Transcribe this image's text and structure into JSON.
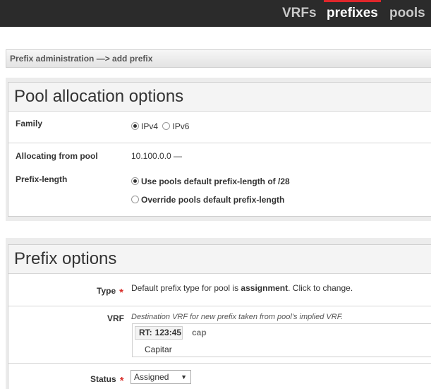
{
  "nav": {
    "items": [
      {
        "label": "VRFs"
      },
      {
        "label": "prefixes"
      },
      {
        "label": "pools"
      }
    ]
  },
  "breadcrumb": "Prefix administration —> add prefix",
  "pool_section": {
    "title": "Pool allocation options",
    "family": {
      "label": "Family",
      "options": [
        {
          "label": "IPv4",
          "checked": true
        },
        {
          "label": "IPv6",
          "checked": false
        }
      ]
    },
    "allocating_from": {
      "label": "Allocating from pool",
      "value": "10.100.0.0 —"
    },
    "prefix_length": {
      "label": "Prefix-length",
      "options": [
        {
          "label": "Use pools default prefix-length of /28",
          "checked": true
        },
        {
          "label": "Override pools default prefix-length",
          "checked": false
        }
      ]
    }
  },
  "prefix_section": {
    "title": "Prefix options",
    "type": {
      "label": "Type",
      "text_before": "Default prefix type for pool is ",
      "text_bold": "assignment",
      "text_after": ". Click to change."
    },
    "vrf": {
      "label": "VRF",
      "hint": "Destination VRF for new prefix taken from pool's implied VRF.",
      "rt_key": "RT:",
      "rt_value": "123:45",
      "name": "cap",
      "description": "Capitar"
    },
    "status": {
      "label": "Status",
      "selected": "Assigned"
    }
  },
  "colors": {
    "topbar": "#2b2b2b",
    "active_accent": "#e0262b",
    "required": "#d9302c"
  }
}
